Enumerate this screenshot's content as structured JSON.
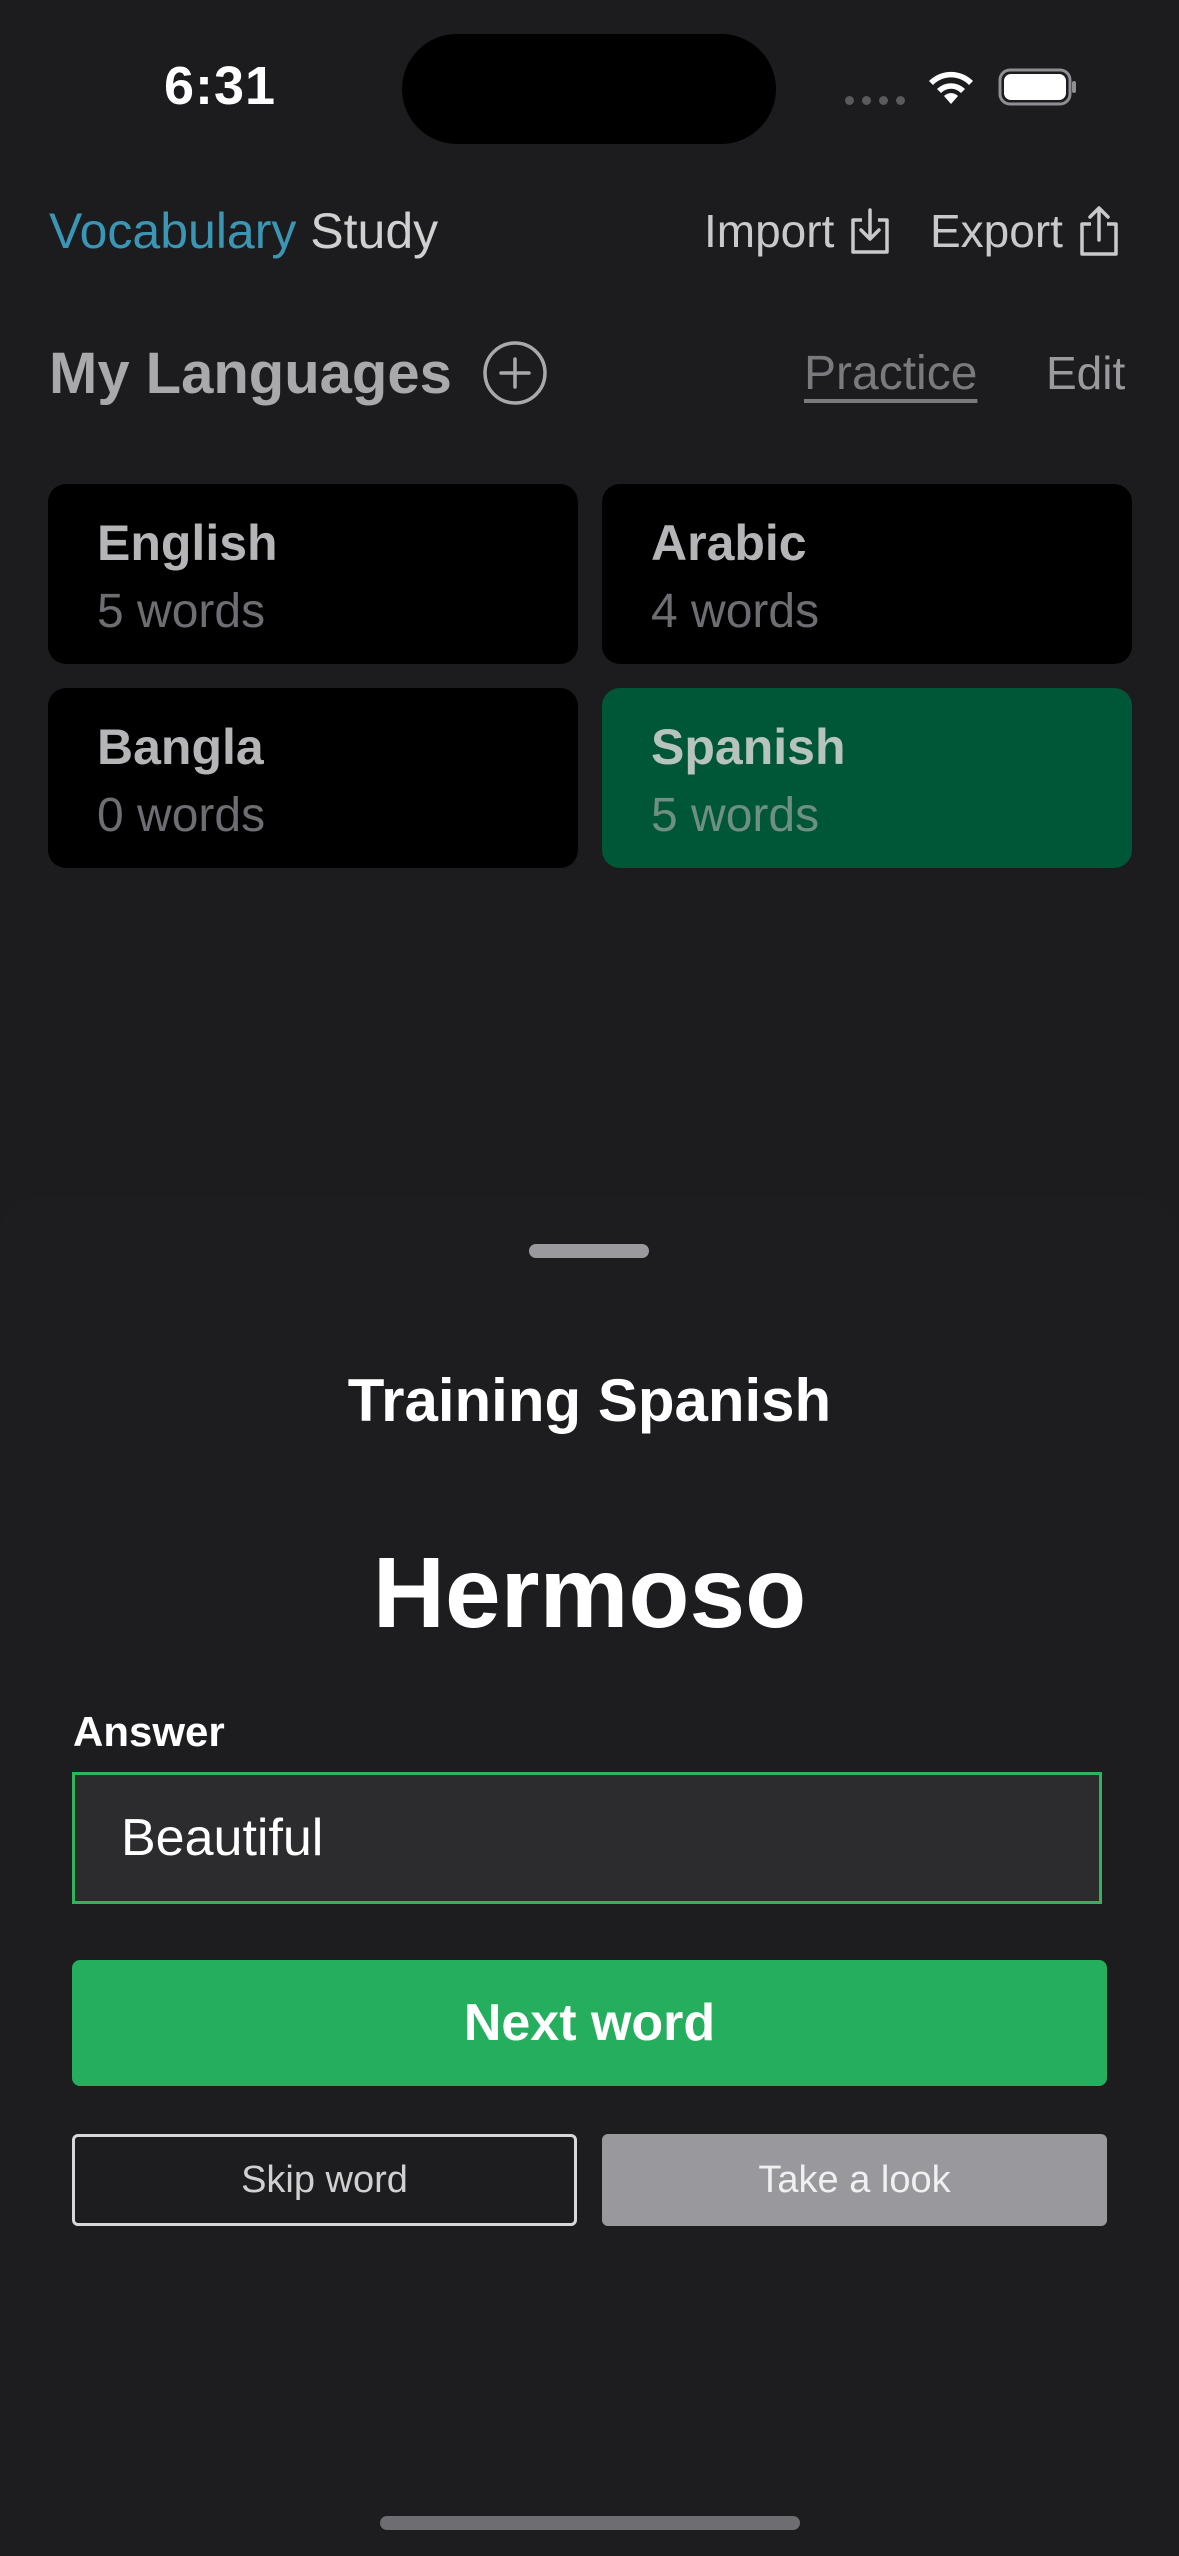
{
  "status_bar": {
    "time": "6:31"
  },
  "header": {
    "brand_accent": "Vocabulary",
    "brand_rest": "Study",
    "import_label": "Import",
    "export_label": "Export"
  },
  "languages": {
    "title": "My Languages",
    "practice_label": "Practice",
    "edit_label": "Edit",
    "items": [
      {
        "name": "English",
        "count": "5 words",
        "selected": false
      },
      {
        "name": "Arabic",
        "count": "4 words",
        "selected": false
      },
      {
        "name": "Bangla",
        "count": "0 words",
        "selected": false
      },
      {
        "name": "Spanish",
        "count": "5 words",
        "selected": true
      }
    ]
  },
  "training": {
    "title": "Training Spanish",
    "word": "Hermoso",
    "answer_label": "Answer",
    "answer_value": "Beautiful",
    "next_label": "Next word",
    "skip_label": "Skip word",
    "look_label": "Take a look"
  },
  "colors": {
    "accent": "#3a96b4",
    "selected_card": "#005738",
    "primary_button": "#25ae5e",
    "input_border": "#2fb35b"
  },
  "icons": {
    "import": "tray-arrow-down-icon",
    "export": "share-arrow-up-icon",
    "add_language": "plus-circle-icon"
  }
}
